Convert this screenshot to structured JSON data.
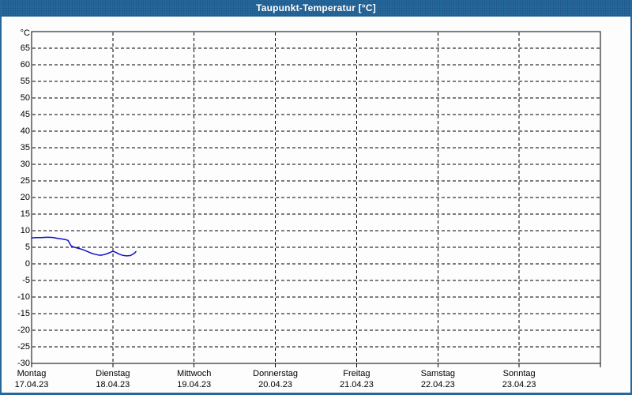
{
  "window": {
    "title": "Taupunkt-Temperatur [°C]",
    "colors": {
      "titlebar": "#26689c",
      "border": "#26689c",
      "background": "#fdfdfd",
      "title_text": "#ffffff",
      "axis_text": "#000000",
      "grid": "#000000"
    }
  },
  "chart_data": {
    "type": "line",
    "title": "Taupunkt-Temperatur [°C]",
    "ylabel": "°C",
    "xlabel": "",
    "ylim": [
      -30,
      70
    ],
    "y_ticks": [
      -30,
      -25,
      -20,
      -15,
      -10,
      -5,
      0,
      5,
      10,
      15,
      20,
      25,
      30,
      35,
      40,
      45,
      50,
      55,
      60,
      65
    ],
    "grid": "dashed",
    "legend_position": "none",
    "x_axis": {
      "range_hours": [
        0,
        168
      ],
      "hours_per_day": 24,
      "day_labels": [
        {
          "weekday": "Montag",
          "date": "17.04.23"
        },
        {
          "weekday": "Dienstag",
          "date": "18.04.23"
        },
        {
          "weekday": "Mittwoch",
          "date": "19.04.23"
        },
        {
          "weekday": "Donnerstag",
          "date": "20.04.23"
        },
        {
          "weekday": "Freitag",
          "date": "21.04.23"
        },
        {
          "weekday": "Samstag",
          "date": "22.04.23"
        },
        {
          "weekday": "Sonntag",
          "date": "23.04.23"
        }
      ]
    },
    "series": [
      {
        "name": "Taupunkt-Temperatur",
        "color": "#1111c8",
        "points_hours_degC": [
          [
            0.0,
            7.8
          ],
          [
            1.2,
            7.9
          ],
          [
            2.8,
            7.9
          ],
          [
            4.2,
            8.0
          ],
          [
            5.4,
            8.0
          ],
          [
            6.5,
            7.9
          ],
          [
            7.7,
            7.7
          ],
          [
            8.9,
            7.5
          ],
          [
            10.0,
            7.3
          ],
          [
            10.7,
            7.1
          ],
          [
            11.2,
            6.3
          ],
          [
            11.7,
            5.4
          ],
          [
            12.4,
            5.1
          ],
          [
            13.3,
            4.8
          ],
          [
            14.5,
            4.5
          ],
          [
            15.6,
            4.1
          ],
          [
            16.8,
            3.6
          ],
          [
            17.7,
            3.2
          ],
          [
            18.7,
            2.9
          ],
          [
            19.6,
            2.7
          ],
          [
            20.5,
            2.6
          ],
          [
            21.5,
            2.8
          ],
          [
            22.4,
            3.1
          ],
          [
            23.3,
            3.5
          ],
          [
            24.0,
            3.8
          ],
          [
            25.0,
            3.4
          ],
          [
            25.9,
            2.9
          ],
          [
            26.8,
            2.6
          ],
          [
            28.0,
            2.4
          ],
          [
            29.2,
            2.5
          ],
          [
            29.9,
            2.9
          ],
          [
            30.6,
            3.4
          ],
          [
            30.8,
            3.7
          ]
        ]
      }
    ]
  }
}
